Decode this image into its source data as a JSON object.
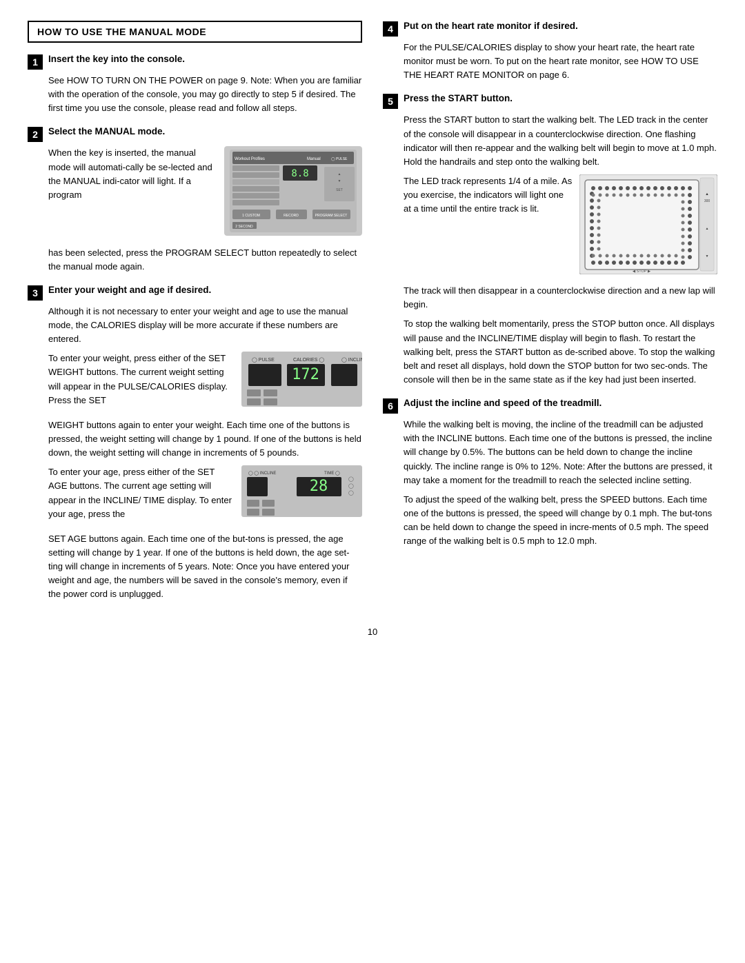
{
  "header": {
    "title": "HOW TO USE THE MANUAL MODE"
  },
  "steps": [
    {
      "number": "1",
      "title": "Insert the key into the console.",
      "paragraphs": [
        "See HOW TO TURN ON THE POWER on page 9. Note: When you are familiar with the operation of the console, you may go directly to step 5 if desired. The first time you use the console, please read and follow all steps."
      ]
    },
    {
      "number": "2",
      "title": "Select the MANUAL mode.",
      "text_before": "When the key is inserted, the manual mode will automati-cally be se-lected and the MANUAL indi-cator will light. If a program",
      "text_after": "has been selected, press the PROGRAM SELECT button repeatedly to select the manual mode again."
    },
    {
      "number": "3",
      "title": "Enter your weight and age if desired.",
      "paragraphs": [
        "Although it is not necessary to enter your weight and age to use the manual mode, the CALORIES display will be more accurate if these numbers are entered.",
        "To enter your weight, press either of the SET WEIGHT buttons. The current weight setting will appear in the PULSE/CALORIES display. Press the SET",
        "WEIGHT buttons again to enter your weight. Each time one of the buttons is pressed, the weight setting will change by 1 pound. If one of the buttons is held down, the weight setting will change in increments of 5 pounds.",
        "To enter your age, press either of the SET AGE buttons. The current age setting will appear in the INCLINE/ TIME display. To enter your age, press the",
        "SET AGE buttons again. Each time one of the but-tons is pressed, the age setting will change by 1 year. If one of the buttons is held down, the age set-ting will change in increments of 5 years. Note: Once you have entered your weight and age, the numbers will be saved in the console's memory, even if the power cord is unplugged."
      ],
      "weight_value": "172",
      "age_value": "28"
    }
  ],
  "right_steps": [
    {
      "number": "4",
      "title": "Put on the heart rate monitor if desired.",
      "paragraphs": [
        "For the PULSE/CALORIES display to show your heart rate, the heart rate monitor must be worn. To put on the heart rate monitor, see HOW TO USE THE HEART RATE MONITOR on page 6."
      ]
    },
    {
      "number": "5",
      "title": "Press the START button.",
      "paragraphs": [
        "Press the START button to start the walking belt. The LED track in the center of the console will disappear in a counterclockwise direction. One flashing indicator will then re-appear and the walking belt will begin to move at 1.0 mph. Hold the handrails and step onto the walking belt.",
        "The LED track represents 1/4 of a mile. As you exercise, the indicators will light one at a time until the entire track is lit.",
        "The track will then disappear in a counterclockwise direction and a new lap will begin.",
        "To stop the walking belt momentarily, press the STOP button once. All displays will pause and the INCLINE/TIME display will begin to flash. To restart the walking belt, press the START button as de-scribed above. To stop the walking belt and reset all displays, hold down the STOP button for two sec-onds. The console will then be in the same state as if the key had just been inserted."
      ],
      "led_text_before": "The LED track represents 1/4 of a mile. As you exercise, the indicators will light one at a time until the entire track is lit."
    },
    {
      "number": "6",
      "title": "Adjust the incline and speed of the treadmill.",
      "paragraphs": [
        "While the walking belt is moving, the incline of the treadmill can be adjusted with the INCLINE buttons. Each time one of the buttons is pressed, the incline will change by 0.5%. The buttons can be held down to change the incline quickly. The incline range is 0% to 12%. Note: After the buttons are pressed, it may take a moment for the treadmill to reach the selected incline setting.",
        "To adjust the speed of the walking belt, press the SPEED buttons. Each time one of the buttons is pressed, the speed will change by 0.1 mph. The but-tons can be held down to change the speed in incre-ments of 0.5 mph. The speed range of the walking belt is 0.5 mph to 12.0 mph."
      ]
    }
  ],
  "page_number": "10"
}
